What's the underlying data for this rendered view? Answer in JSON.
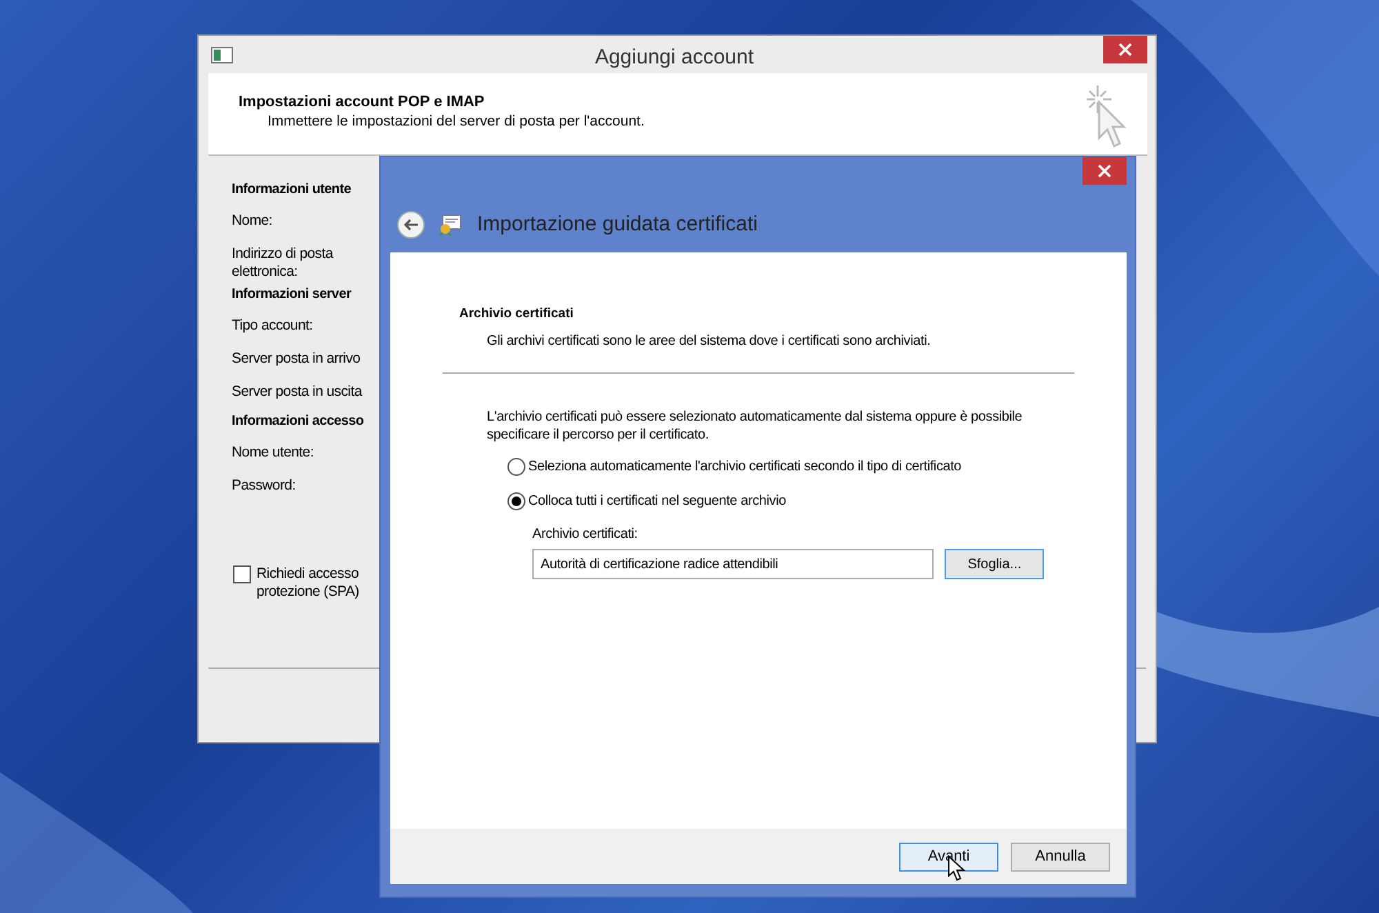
{
  "back_window": {
    "title": "Aggiungi account",
    "header_title": "Impostazioni account POP e IMAP",
    "header_subtitle": "Immettere le impostazioni del server di posta per l'account.",
    "sections": [
      {
        "kind": "heading",
        "text": "Informazioni utente"
      },
      {
        "kind": "label",
        "text": "Nome:"
      },
      {
        "kind": "label",
        "text": "Indirizzo di posta elettronica:"
      },
      {
        "kind": "heading",
        "text": "Informazioni server"
      },
      {
        "kind": "label",
        "text": "Tipo account:"
      },
      {
        "kind": "label",
        "text": "Server posta in arrivo"
      },
      {
        "kind": "label",
        "text": "Server posta in uscita"
      },
      {
        "kind": "heading",
        "text": "Informazioni accesso"
      },
      {
        "kind": "label",
        "text": "Nome utente:"
      },
      {
        "kind": "label",
        "text": "Password:"
      }
    ],
    "spa_checkbox": {
      "label_line1": "Richiedi accesso",
      "label_line2": "protezione (SPA)",
      "checked": false
    }
  },
  "wizard": {
    "title": "Importazione guidata certificati",
    "section_title": "Archivio certificati",
    "section_subtitle": "Gli archivi certificati sono le aree del sistema dove i certificati sono archiviati.",
    "intro": "L'archivio certificati può essere selezionato automaticamente dal sistema oppure è possibile specificare il percorso per il certificato.",
    "options": [
      {
        "label": "Seleziona automaticamente l'archivio certificati secondo il tipo di certificato",
        "selected": false
      },
      {
        "label": "Colloca tutti i certificati nel seguente archivio",
        "selected": true
      }
    ],
    "store_label": "Archivio certificati:",
    "store_value": "Autorità di certificazione radice attendibili",
    "browse_button": "Sfoglia...",
    "buttons": [
      {
        "label": "Avanti",
        "kind": "default"
      },
      {
        "label": "Annulla",
        "kind": "normal"
      }
    ]
  }
}
